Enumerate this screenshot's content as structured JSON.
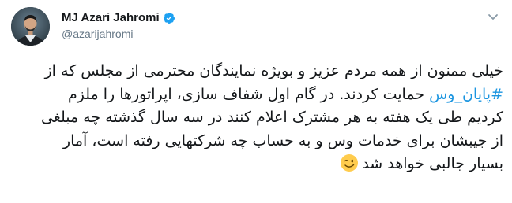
{
  "author": {
    "display_name": "MJ Azari Jahromi",
    "handle": "@azarijahromi",
    "verified_icon": "verified-badge-icon",
    "avatar_icon": "avatar"
  },
  "menu_icon": "chevron-down-icon",
  "tweet": {
    "line1": "خیلی ممنون از همه مردم عزیز و بویژه نمایندگان محترمی از مجلس که از",
    "line2_hashtag": "#پایان_وس",
    "line2_rest": " حمایت کردند. در گام اول شفاف سازی، اپراتورها را ملزم",
    "line3": "کردیم طی یک هفته به هر مشترک اعلام کنند در سه سال گذشته چه مبلغی",
    "line4": "از جیبشان برای خدمات وس و به حساب چه شرکتهایی رفته است، آمار",
    "line5": "بسیار جالبی خواهد شد",
    "emoji": "winking-face-emoji"
  },
  "colors": {
    "text": "#14171a",
    "muted": "#657786",
    "link": "#1b95e0",
    "verified": "#1da1f2"
  }
}
